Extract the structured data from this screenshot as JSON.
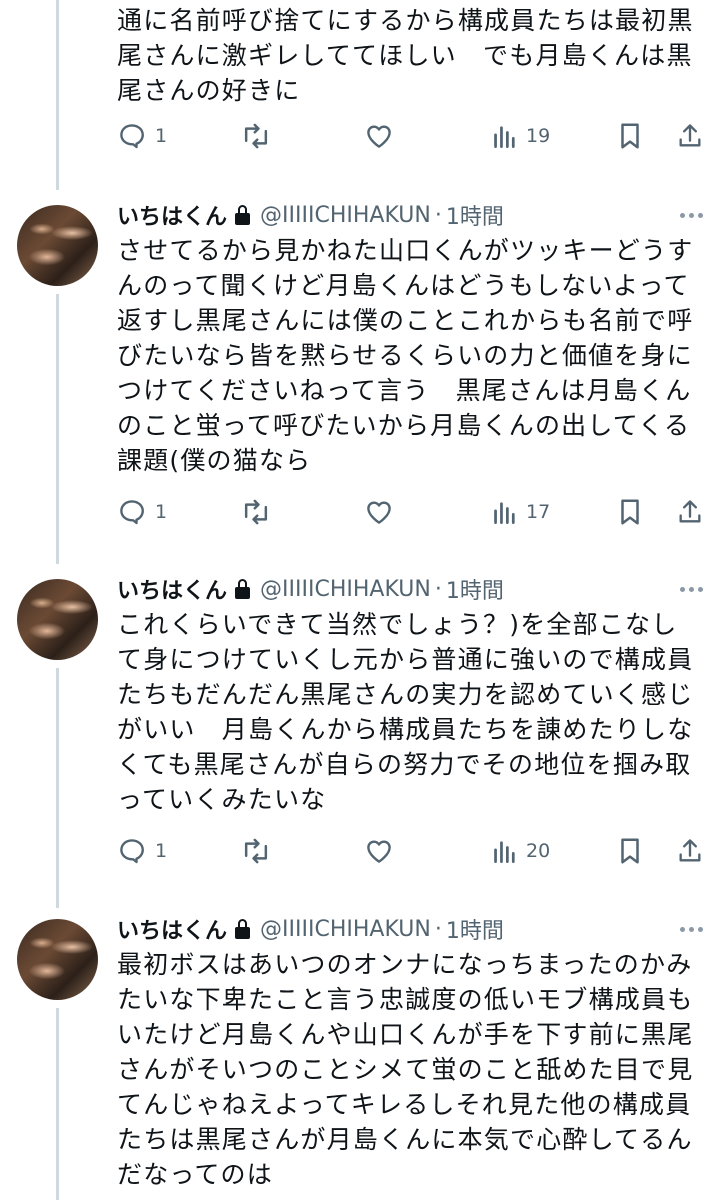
{
  "colors": {
    "text": "#0f1419",
    "secondary": "#536471",
    "thread_line": "#cfd9de",
    "background": "#ffffff"
  },
  "tweets": [
    {
      "partial": true,
      "text": "通に名前呼び捨てにするから構成員たちは最初黒\n尾さんに激ギレしててほしい　でも月島くんは黒\n尾さんの好きに",
      "stats": {
        "replies": "1",
        "views": "19"
      }
    },
    {
      "name": "いちはくん",
      "handle": "@IIIIICHIHAKUN",
      "time": "1時間",
      "text": "させてるから見かねた山口くんがツッキーどうす\nんのって聞くけど月島くんはどうもしないよって\n返すし黒尾さんには僕のことこれからも名前で呼\nびたいなら皆を黙らせるくらいの力と価値を身に\nつけてくださいねって言う　黒尾さんは月島くん\nのこと蛍って呼びたいから月島くんの出してくる\n課題(僕の猫なら",
      "stats": {
        "replies": "1",
        "views": "17"
      }
    },
    {
      "name": "いちはくん",
      "handle": "@IIIIICHIHAKUN",
      "time": "1時間",
      "text": "これくらいできて当然でしょう？)を全部こなし\nて身につけていくし元から普通に強いので構成員\nたちもだんだん黒尾さんの実力を認めていく感じ\nがいい　月島くんから構成員たちを諌めたりしな\nくても黒尾さんが自らの努力でその地位を掴み取\nっていくみたいな",
      "stats": {
        "replies": "1",
        "views": "20"
      }
    },
    {
      "name": "いちはくん",
      "handle": "@IIIIICHIHAKUN",
      "time": "1時間",
      "text": "最初ボスはあいつのオンナになっちまったのかみ\nたいな下卑たこと言う忠誠度の低いモブ構成員も\nいたけど月島くんや山口くんが手を下す前に黒尾\nさんがそいつのことシメて蛍のこと舐めた目で見\nてんじゃねえよってキレるしそれ見た他の構成員\nたちは黒尾さんが月島くんに本気で心酔してるん\nだなってのは"
    }
  ]
}
